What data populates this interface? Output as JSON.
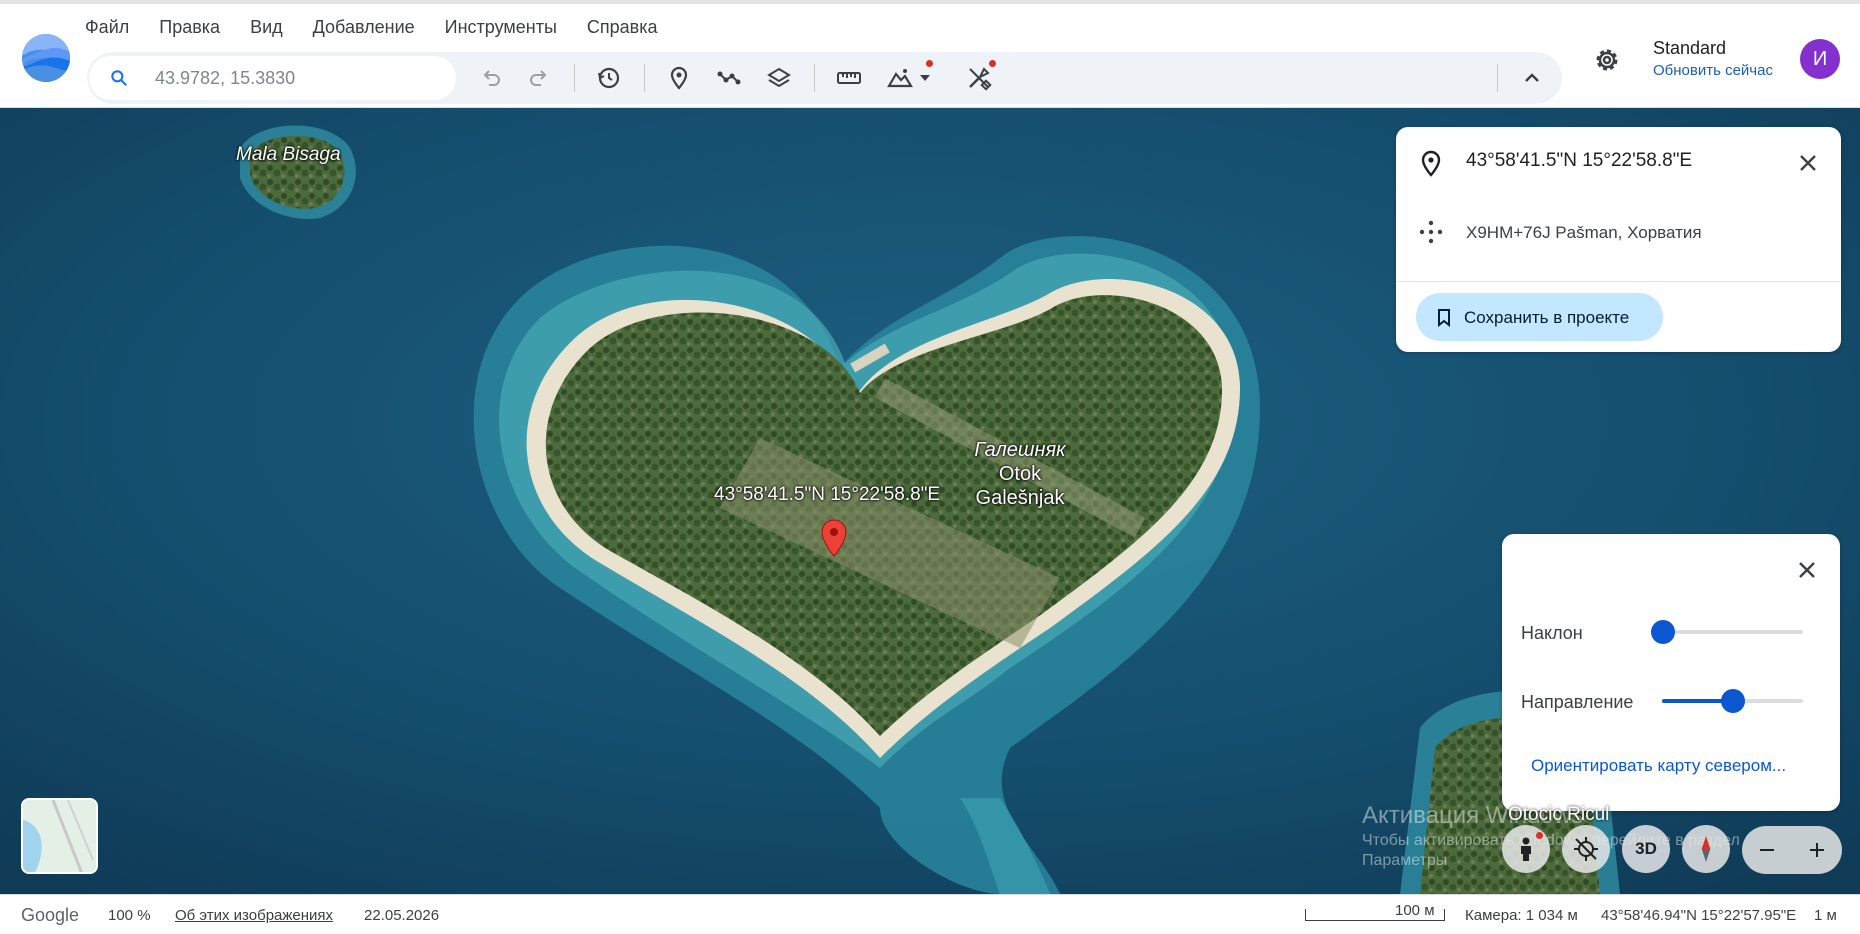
{
  "menu": [
    "Файл",
    "Правка",
    "Вид",
    "Добавление",
    "Инструменты",
    "Справка"
  ],
  "search": {
    "placeholder": "43.9782, 15.3830",
    "icon": "search-icon"
  },
  "toolbar": {
    "icons": [
      "undo-icon",
      "redo-icon",
      "history-icon",
      "placemark-icon",
      "path-icon",
      "layers-icon",
      "measure-icon",
      "elevation-icon",
      "tools-icon",
      "collapse-icon"
    ],
    "notification_color": "#d93025"
  },
  "account": {
    "style": "Standard",
    "update": "Обновить сейчас",
    "avatar_letter": "И",
    "avatar_color": "#8430ce"
  },
  "map": {
    "labels": {
      "mala_bisaga": "Mala Bisaga",
      "pin": "43°58'41.5\"N 15°22'58.8\"E",
      "galesnjak_ru": "Галешняк",
      "galesnjak_1": "Otok",
      "galesnjak_2": "Galešnjak",
      "otocic": "Otocic Ricul"
    },
    "watermark": [
      "Активация Windows",
      "Чтобы активировать Windows, перейдите в раздел",
      "Параметры"
    ]
  },
  "info_panel": {
    "coords": "43°58'41.5\"N 15°22'58.8\"E",
    "plus_code": "X9HM+76J Pašman, Хорватия",
    "save_label": "Сохранить в проекте",
    "save_color": "#c2e7ff"
  },
  "tilt_panel": {
    "tilt_label": "Наклон",
    "tilt_value": 0,
    "heading_label": "Направление",
    "heading_value": 0.5,
    "north_link": "Ориентировать карту севером..."
  },
  "controls": {
    "btn_3d": "3D",
    "zoom_out": "−",
    "zoom_in": "+"
  },
  "status": {
    "brand": "Google",
    "zoom": "100 %",
    "about": "Об этих изображениях",
    "date": "22.05.2026",
    "scale": "100 м",
    "camera": "Камера: 1 034 м",
    "cursor": "43°58'46.94\"N 15°22'57.95\"E",
    "elevation": "1 м"
  }
}
